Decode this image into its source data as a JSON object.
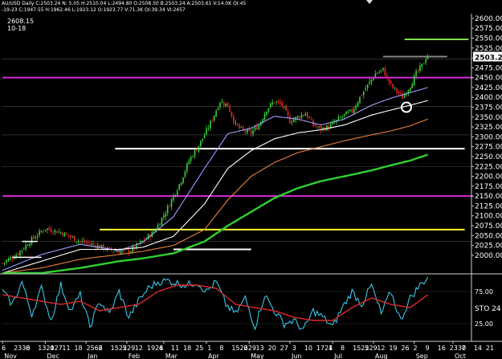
{
  "header": {
    "line1": "AU/USD Daily  C:2503.24  N:  5.05  H:2510.04  L:2494.80  O:2508.50  B:2503.24  A:2503.61  V:14.0K  OI:45",
    "line2": "-19-23  C:1947.55  H:1962.46  L:1923.12  O:1923.77  V:71.3K  OI:39.34  VI:2457",
    "value": "2608.15",
    "date": "10-18"
  },
  "chart_data": [
    {
      "type": "line",
      "title": "",
      "instrument": "AU/USD Daily",
      "price_axis": {
        "ticks": [
          2600,
          2575,
          2550,
          2525,
          2500,
          2475,
          2450,
          2425,
          2400,
          2375,
          2350,
          2325,
          2300,
          2275,
          2250,
          2225,
          2200,
          2175,
          2150,
          2125,
          2100,
          2075,
          2050,
          2025,
          2000
        ],
        "tick_labels": [
          "2600.00",
          "2575.00",
          "2550.00",
          "2525.00",
          "2500.00",
          "2475.00",
          "2450.00",
          "2425.00",
          "2400.00",
          "2375.00",
          "2350.00",
          "2325.00",
          "2300.00",
          "2275.00",
          "2250.00",
          "2225.00",
          "2200.00",
          "2175.00",
          "2150.00",
          "2125.00",
          "2100.00",
          "2075.00",
          "2050.00",
          "2025.00",
          "2000.00"
        ],
        "ylim": [
          1955,
          2612
        ]
      },
      "last_price": 2503.24,
      "last_price_label": "2503.24",
      "time_axis": {
        "day_labels": [
          "6",
          "2330",
          "6",
          "132027",
          "4",
          "11",
          "18",
          "2562",
          "8",
          "152229",
          "5",
          "12",
          "1926",
          "4",
          "11",
          "18",
          "25",
          "1",
          "8",
          "152229",
          "6",
          "13",
          "20",
          "27",
          "3",
          "10",
          "1724",
          "1",
          "8",
          "152229",
          "5",
          "12",
          "19",
          "26",
          "2",
          "9",
          "16",
          "2330",
          "7",
          "14",
          "21"
        ],
        "month_labels": [
          "Nov",
          "Dec",
          "Jan",
          "Feb",
          "Mar",
          "Apr",
          "May",
          "Jun",
          "Jul",
          "Aug",
          "Sep",
          "Oct"
        ],
        "month_positions": [
          0,
          22,
          43,
          64,
          83,
          105,
          127,
          148,
          170,
          191,
          212,
          232
        ],
        "n_bars": 242
      },
      "close_anchors": [
        [
          0,
          1980
        ],
        [
          8,
          2005
        ],
        [
          15,
          2040
        ],
        [
          22,
          2068
        ],
        [
          30,
          2058
        ],
        [
          40,
          2035
        ],
        [
          48,
          2025
        ],
        [
          54,
          2015
        ],
        [
          60,
          2010
        ],
        [
          66,
          2012
        ],
        [
          72,
          2035
        ],
        [
          78,
          2060
        ],
        [
          84,
          2110
        ],
        [
          88,
          2150
        ],
        [
          92,
          2190
        ],
        [
          96,
          2240
        ],
        [
          100,
          2270
        ],
        [
          104,
          2305
        ],
        [
          108,
          2345
        ],
        [
          112,
          2390
        ],
        [
          116,
          2380
        ],
        [
          120,
          2330
        ],
        [
          124,
          2315
        ],
        [
          128,
          2310
        ],
        [
          132,
          2330
        ],
        [
          136,
          2370
        ],
        [
          140,
          2390
        ],
        [
          144,
          2380
        ],
        [
          148,
          2340
        ],
        [
          152,
          2350
        ],
        [
          156,
          2360
        ],
        [
          160,
          2330
        ],
        [
          164,
          2320
        ],
        [
          168,
          2325
        ],
        [
          172,
          2340
        ],
        [
          176,
          2355
        ],
        [
          180,
          2365
        ],
        [
          184,
          2400
        ],
        [
          188,
          2430
        ],
        [
          192,
          2460
        ],
        [
          196,
          2470
        ],
        [
          200,
          2430
        ],
        [
          204,
          2410
        ],
        [
          206,
          2400
        ],
        [
          210,
          2430
        ],
        [
          213,
          2460
        ],
        [
          216,
          2480
        ],
        [
          218,
          2500
        ],
        [
          219,
          2503.24
        ]
      ],
      "moving_averages": [
        {
          "color": "#9d9dff",
          "anchors": [
            [
              0,
              1962
            ],
            [
              20,
              2002
            ],
            [
              40,
              2028
            ],
            [
              60,
              2012
            ],
            [
              72,
              2032
            ],
            [
              88,
              2098
            ],
            [
              104,
              2220
            ],
            [
              116,
              2308
            ],
            [
              128,
              2322
            ],
            [
              140,
              2352
            ],
            [
              152,
              2345
            ],
            [
              164,
              2330
            ],
            [
              176,
              2345
            ],
            [
              190,
              2380
            ],
            [
              200,
              2398
            ],
            [
              210,
              2412
            ],
            [
              219,
              2425
            ]
          ]
        },
        {
          "color": "#ffffff",
          "anchors": [
            [
              0,
              1955
            ],
            [
              20,
              1985
            ],
            [
              40,
              2015
            ],
            [
              60,
              2015
            ],
            [
              72,
              2020
            ],
            [
              88,
              2048
            ],
            [
              104,
              2130
            ],
            [
              116,
              2220
            ],
            [
              128,
              2265
            ],
            [
              140,
              2295
            ],
            [
              152,
              2310
            ],
            [
              164,
              2318
            ],
            [
              176,
              2330
            ],
            [
              190,
              2355
            ],
            [
              200,
              2368
            ],
            [
              210,
              2380
            ],
            [
              219,
              2392
            ]
          ]
        },
        {
          "color": "#e8803c",
          "anchors": [
            [
              0,
              1955
            ],
            [
              20,
              1968
            ],
            [
              40,
              1990
            ],
            [
              60,
              2002
            ],
            [
              72,
              2010
            ],
            [
              88,
              2025
            ],
            [
              104,
              2065
            ],
            [
              116,
              2140
            ],
            [
              128,
              2200
            ],
            [
              140,
              2235
            ],
            [
              152,
              2260
            ],
            [
              164,
              2275
            ],
            [
              176,
              2290
            ],
            [
              190,
              2305
            ],
            [
              200,
              2315
            ],
            [
              210,
              2328
            ],
            [
              219,
              2345
            ]
          ]
        },
        {
          "color": "#2fd12f",
          "anchors": [
            [
              0,
              1955
            ],
            [
              20,
              1955
            ],
            [
              40,
              1968
            ],
            [
              60,
              1985
            ],
            [
              72,
              1992
            ],
            [
              88,
              2005
            ],
            [
              104,
              2035
            ],
            [
              116,
              2075
            ],
            [
              128,
              2110
            ],
            [
              140,
              2145
            ],
            [
              152,
              2170
            ],
            [
              164,
              2188
            ],
            [
              176,
              2200
            ],
            [
              190,
              2215
            ],
            [
              200,
              2228
            ],
            [
              210,
              2240
            ],
            [
              219,
              2255
            ]
          ]
        }
      ],
      "horizontal_levels": [
        {
          "price": 2547,
          "color": "#7ee04a",
          "from_bar": 207,
          "to_bar": 240
        },
        {
          "price": 2503.24,
          "color": "#888888",
          "from_bar": 196,
          "to_bar": 229
        },
        {
          "price": 2450,
          "color": "#d42cd4",
          "from_bar": 0,
          "to_bar": 242
        },
        {
          "price": 2270,
          "color": "#ffffff",
          "from_bar": 58,
          "to_bar": 238
        },
        {
          "price": 2150,
          "color": "#d42cd4",
          "from_bar": 0,
          "to_bar": 242
        },
        {
          "price": 2065,
          "color": "#ffff33",
          "from_bar": 50,
          "to_bar": 238
        },
        {
          "price": 2015,
          "color": "#ffffff",
          "from_bar": 88,
          "to_bar": 128
        }
      ],
      "grid_levels": [
        2497,
        2377,
        2305,
        2225,
        2035
      ],
      "highlight_circle": {
        "bar": 208,
        "price": 2375
      }
    },
    {
      "type": "line",
      "title": "STO 24",
      "ylim": [
        0,
        100
      ],
      "tick_labels": [
        "75.00",
        "25.00"
      ],
      "levels": [
        75,
        25
      ],
      "fast": {
        "color": "#38c8e8",
        "anchors": [
          [
            0,
            75
          ],
          [
            5,
            55
          ],
          [
            10,
            90
          ],
          [
            15,
            40
          ],
          [
            20,
            80
          ],
          [
            25,
            30
          ],
          [
            30,
            85
          ],
          [
            35,
            45
          ],
          [
            40,
            70
          ],
          [
            45,
            20
          ],
          [
            50,
            60
          ],
          [
            55,
            40
          ],
          [
            60,
            75
          ],
          [
            65,
            35
          ],
          [
            70,
            60
          ],
          [
            75,
            80
          ],
          [
            80,
            90
          ],
          [
            85,
            92
          ],
          [
            90,
            88
          ],
          [
            95,
            85
          ],
          [
            100,
            90
          ],
          [
            105,
            75
          ],
          [
            110,
            90
          ],
          [
            115,
            55
          ],
          [
            120,
            40
          ],
          [
            125,
            65
          ],
          [
            130,
            20
          ],
          [
            135,
            70
          ],
          [
            140,
            45
          ],
          [
            145,
            25
          ],
          [
            150,
            30
          ],
          [
            155,
            15
          ],
          [
            160,
            45
          ],
          [
            165,
            35
          ],
          [
            170,
            20
          ],
          [
            175,
            50
          ],
          [
            180,
            75
          ],
          [
            185,
            55
          ],
          [
            190,
            85
          ],
          [
            195,
            40
          ],
          [
            200,
            75
          ],
          [
            205,
            30
          ],
          [
            210,
            65
          ],
          [
            215,
            85
          ],
          [
            219,
            97
          ]
        ]
      },
      "slow": {
        "color": "#e02828",
        "anchors": [
          [
            0,
            70
          ],
          [
            10,
            65
          ],
          [
            20,
            60
          ],
          [
            30,
            55
          ],
          [
            40,
            60
          ],
          [
            50,
            45
          ],
          [
            60,
            50
          ],
          [
            70,
            55
          ],
          [
            80,
            75
          ],
          [
            90,
            85
          ],
          [
            100,
            85
          ],
          [
            110,
            80
          ],
          [
            120,
            55
          ],
          [
            130,
            50
          ],
          [
            140,
            45
          ],
          [
            150,
            35
          ],
          [
            160,
            30
          ],
          [
            170,
            30
          ],
          [
            180,
            50
          ],
          [
            190,
            65
          ],
          [
            200,
            55
          ],
          [
            210,
            50
          ],
          [
            219,
            70
          ]
        ]
      }
    }
  ]
}
